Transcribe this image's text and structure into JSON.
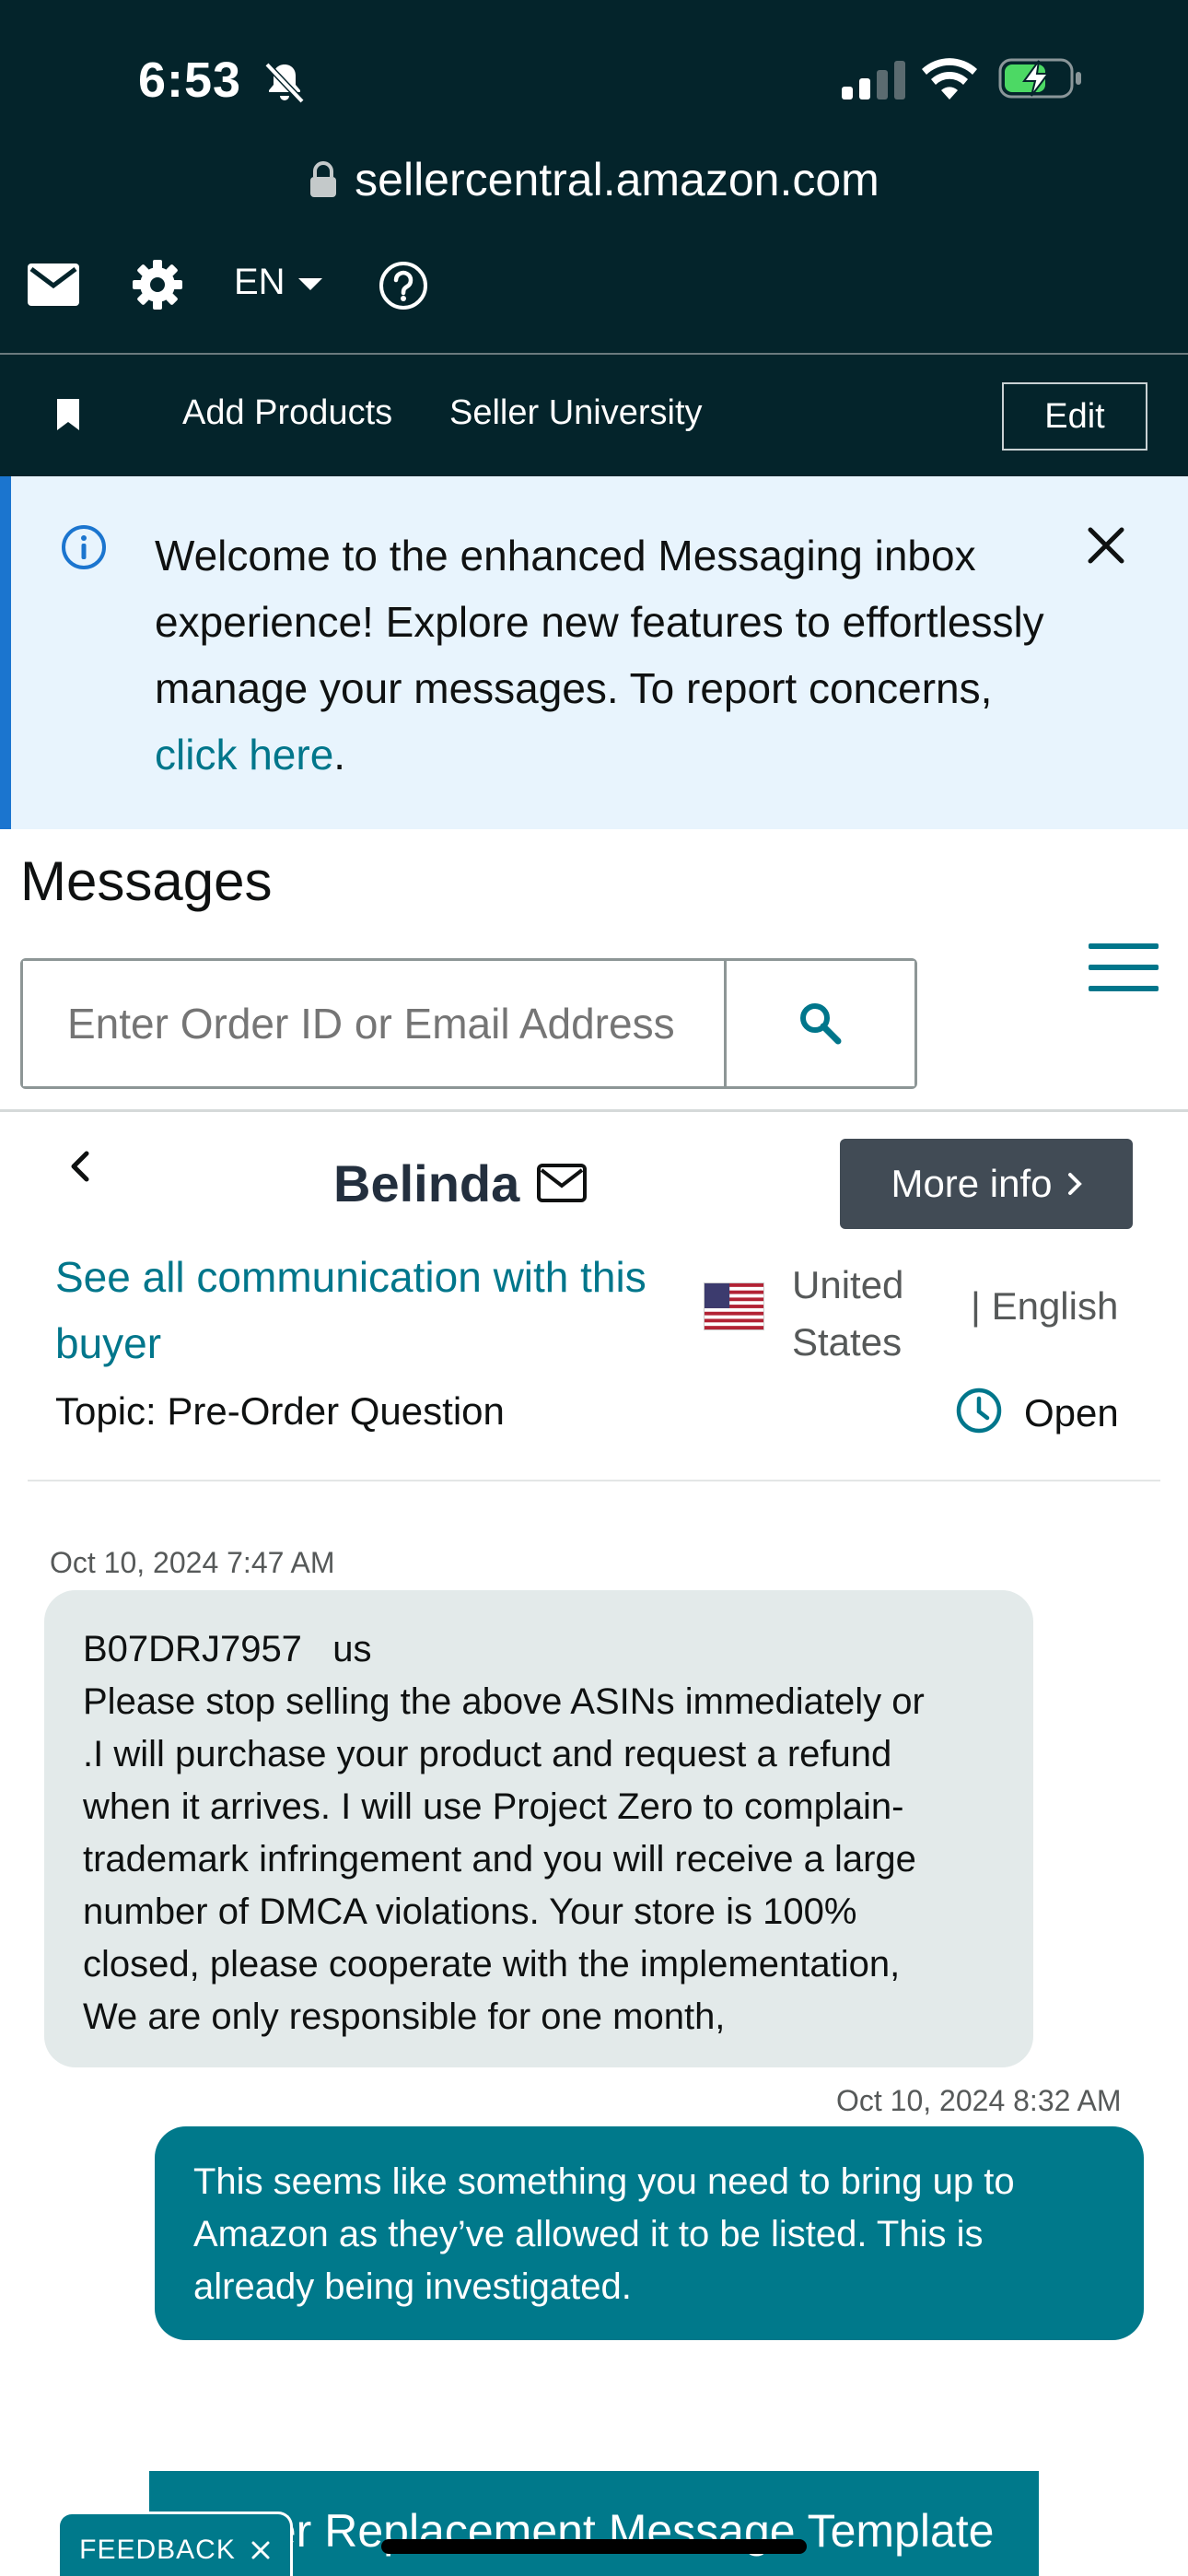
{
  "status_bar": {
    "time": "6:53",
    "icons": [
      "bell-off-icon",
      "signal-icon",
      "wifi-icon",
      "battery-charging-icon"
    ]
  },
  "browser": {
    "url": "sellercentral.amazon.com"
  },
  "toolbar": {
    "language": "EN",
    "icons": [
      "mail-icon",
      "gear-icon",
      "help-icon"
    ]
  },
  "nav": {
    "items": [
      {
        "label": "Add Products"
      },
      {
        "label": "Seller University"
      }
    ],
    "edit_label": "Edit"
  },
  "banner": {
    "text": "Welcome to the enhanced Messaging inbox experience! Explore new features to effort­lessly manage your messages. To report con­cerns, ",
    "link": "click here",
    "suffix": "."
  },
  "messages": {
    "title": "Messages",
    "search_placeholder": "Enter Order ID or Email Address"
  },
  "conversation": {
    "buyer": "Belinda",
    "more_info": "More info",
    "see_all": "See all communication with this buyer",
    "country": "United States",
    "language": "| English",
    "topic": "Topic: Pre-Order Question",
    "status": "Open"
  },
  "thread": [
    {
      "direction": "incoming",
      "timestamp": "Oct 10, 2024 7:47 AM",
      "lines": [
        "B07DRJ7957   us",
        "Please stop selling the above ASINs immediately or",
        ".I will purchase your product and request a refund",
        "when it arrives. I will use Project Zero to complain-",
        "trademark infringement and you will receive a large",
        "number of DMCA violations. Your store is 100%",
        "closed, please cooperate with the implementation,",
        "We are only responsible for one month,"
      ]
    },
    {
      "direction": "outgoing",
      "timestamp": "Oct 10, 2024 8:32 AM",
      "text": "This seems like something you need to bring up to Amazon as they’ve allowed it to be listed. This is already being investigated."
    }
  ],
  "bottom": {
    "template_button": "Order Replacement Message Template",
    "feedback": "FEEDBACK"
  },
  "colors": {
    "header_bg": "#04242b",
    "teal": "#00798b",
    "link": "#00768b",
    "banner_bg": "#e8f4fd",
    "banner_accent": "#1b75cf"
  }
}
